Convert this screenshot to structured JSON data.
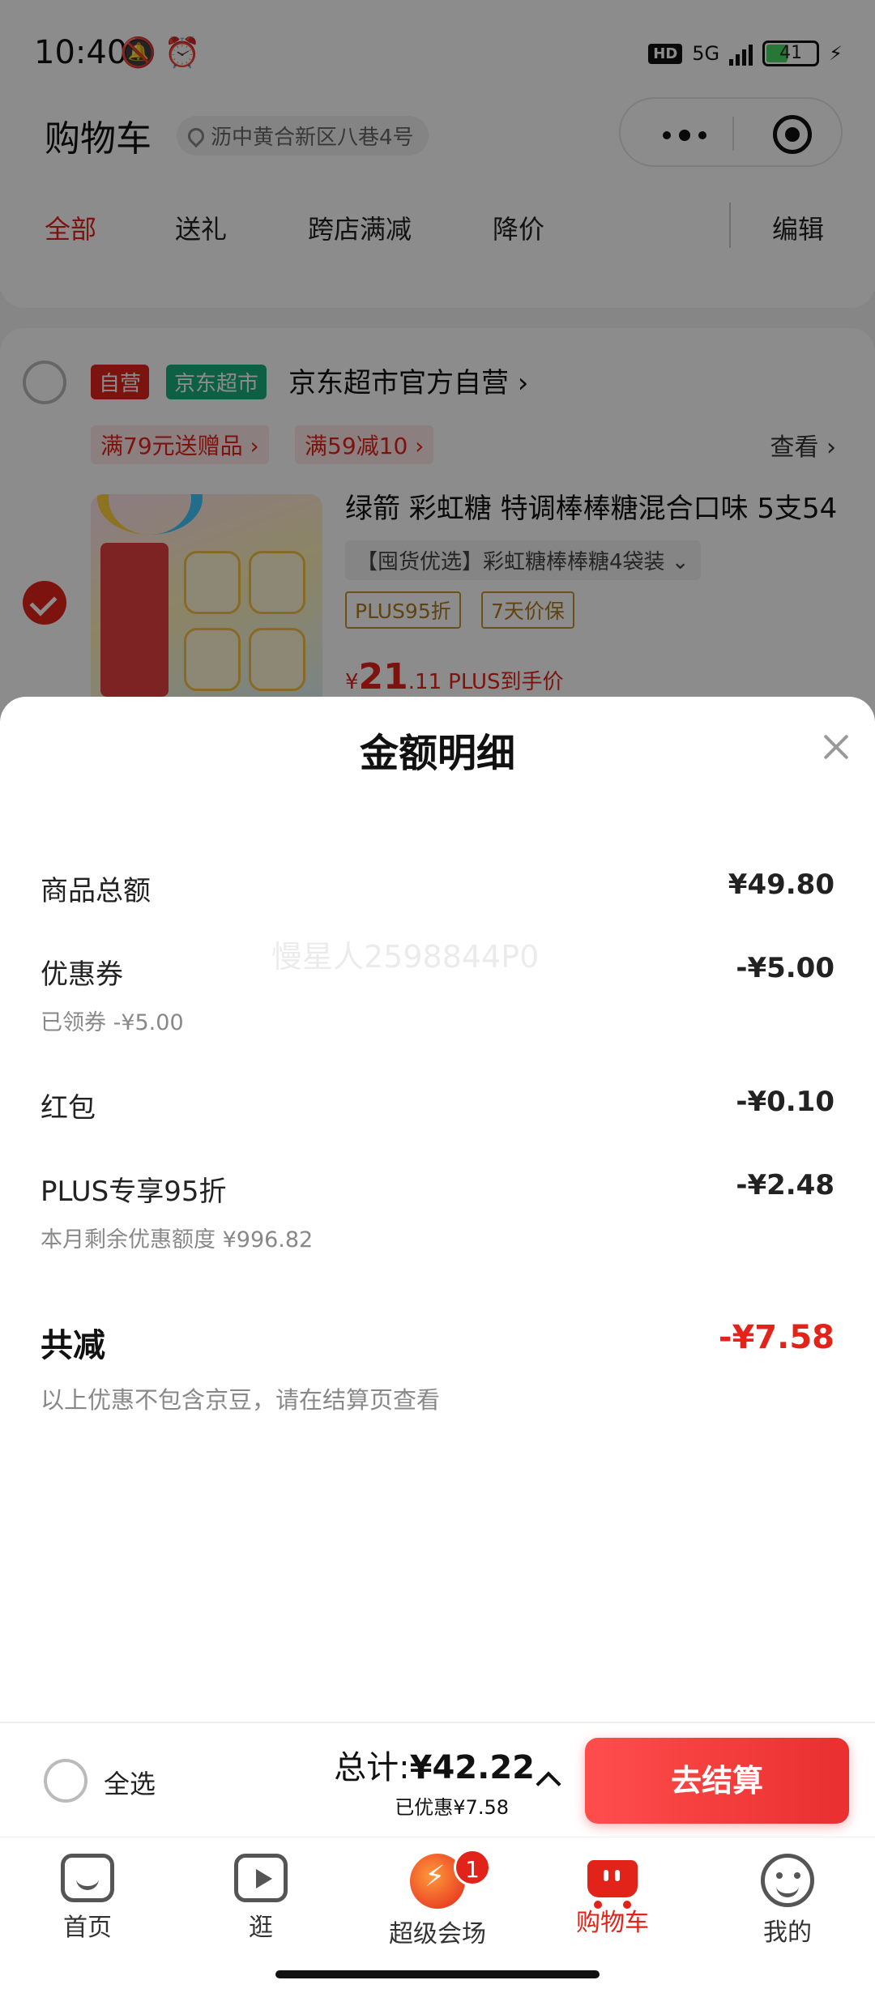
{
  "status_bar": {
    "time": "10:40",
    "network": "5G",
    "battery": "41"
  },
  "header": {
    "title": "购物车",
    "location": "沥中黄合新区八巷4号"
  },
  "tabs": [
    {
      "label": "全部",
      "active": true
    },
    {
      "label": "送礼",
      "active": false
    },
    {
      "label": "跨店满减",
      "active": false
    },
    {
      "label": "降价",
      "active": false
    },
    {
      "label": "编辑",
      "active": false
    }
  ],
  "store": {
    "badge_self": "自营",
    "badge_market": "京东超市",
    "name": "京东超市官方自营 ›",
    "promos": [
      "满79元送赠品 ›",
      "满59减10 ›"
    ],
    "view_link": "查看 ›"
  },
  "product": {
    "title": "绿箭 彩虹糖 特调棒棒糖混合口味 5支54",
    "variant": "【囤货优选】彩虹糖棒棒糖4袋装 ⌄",
    "tags": [
      "PLUS95折",
      "7天价保"
    ],
    "price_symbol": "¥",
    "price_int": "21",
    "price_dec": ".11",
    "price_note": "PLUS到手价"
  },
  "sheet": {
    "title": "金额明细",
    "watermark": "慢星人2598844P0",
    "rows": [
      {
        "label": "商品总额",
        "value": "¥49.80",
        "sub": ""
      },
      {
        "label": "优惠券",
        "value": "-¥5.00",
        "sub": "已领券 -¥5.00"
      },
      {
        "label": "红包",
        "value": "-¥0.10",
        "sub": ""
      },
      {
        "label": "PLUS专享95折",
        "value": "-¥2.48",
        "sub": "本月剩余优惠额度 ¥996.82"
      }
    ],
    "total_label": "共减",
    "total_value": "-¥7.58",
    "note": "以上优惠不包含京豆，请在结算页查看"
  },
  "checkout": {
    "select_all": "全选",
    "total_prefix": "总计:",
    "total_amount": "¥42.22",
    "saved": "已优惠¥7.58",
    "button": "去结算"
  },
  "bottom_nav": [
    {
      "label": "首页",
      "icon": "home-icon"
    },
    {
      "label": "逛",
      "icon": "play-icon"
    },
    {
      "label": "超级会场",
      "icon": "super-venue-icon",
      "badge": "1"
    },
    {
      "label": "购物车",
      "icon": "cart-icon",
      "active": true
    },
    {
      "label": "我的",
      "icon": "me-icon"
    }
  ],
  "colors": {
    "accent": "#e2231a",
    "market_green": "#18b07a",
    "plus_gold": "#b07a1a"
  }
}
